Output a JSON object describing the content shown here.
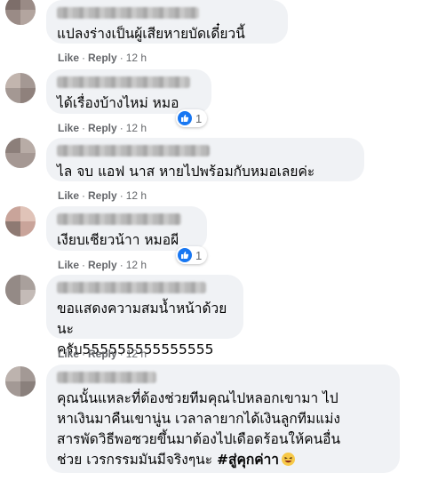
{
  "comments": [
    {
      "text": "แปลงร่างเป็นผู้เสียหายบัดเดี๋ยวนี้",
      "like_label": "Like",
      "reply_label": "Reply",
      "time": "12 h"
    },
    {
      "text": "ได้เรื่องบ้างไหม่ หมอ",
      "like_label": "Like",
      "reply_label": "Reply",
      "time": "12 h",
      "reaction_count": "1"
    },
    {
      "text": "ไล จบ แอฟ นาส หายไปพร้อมกับหมอเลยค่ะ",
      "like_label": "Like",
      "reply_label": "Reply",
      "time": "12 h"
    },
    {
      "text": "เงียบเชียวน้าา หมอผี",
      "like_label": "Like",
      "reply_label": "Reply",
      "time": "12 h",
      "reaction_count": "1"
    },
    {
      "text": "ขอแสดงความสมน้ำหน้าด้วยนะ\nครับ555555555555555",
      "like_label": "Like",
      "reply_label": "Reply",
      "time": "12 h"
    },
    {
      "text": "คุณนั้นแหละที่ต้องช่วยทีมคุณไปหลอกเขามา ไป\nหาเงินมาคืนเขานู่น เวลาลายากได้เงินลูกทีมแม่ง\nสารพัดวิธีพอซวยขึ้นมาต้องไปเดือดร้อนให้คนอื่น\nช่วย เวรกรรมมันมีจริงๆนะ ",
      "hashtag": "#สู่คุกค่าา"
    }
  ],
  "colors": {
    "bubble": "#f0f2f5",
    "meta": "#65676b",
    "like_blue": "#1877f2"
  },
  "icons": {
    "reaction": "like-thumb-icon",
    "emoji": "laughing-emoji-icon"
  }
}
